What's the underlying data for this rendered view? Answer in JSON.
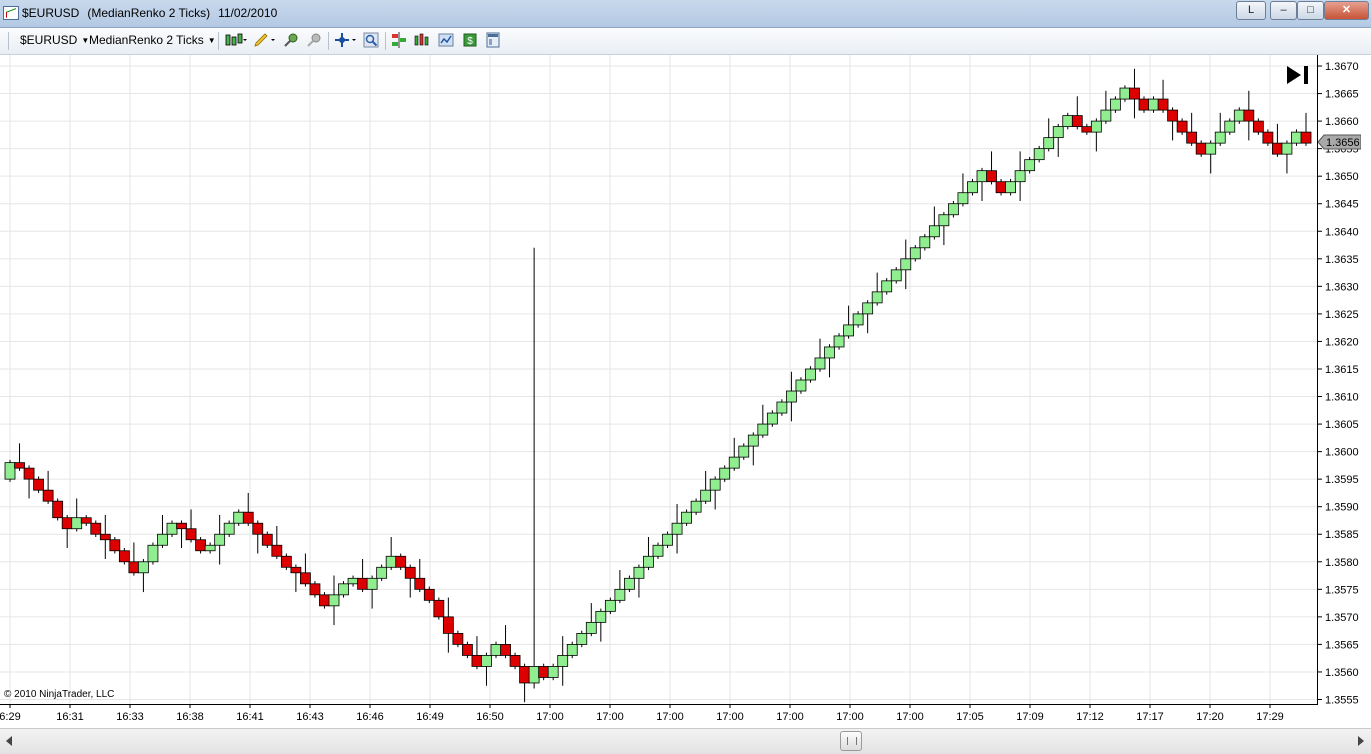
{
  "window": {
    "title_symbol": "$EURUSD",
    "title_type": "(MedianRenko 2 Ticks)",
    "title_date": "11/02/2010",
    "btn_l": "L",
    "btn_min": "–",
    "btn_max": "□",
    "btn_close": "✕"
  },
  "toolbar": {
    "instrument": "$EURUSD",
    "period": "MedianRenko 2 Ticks",
    "icons": [
      "candlestick-style-icon",
      "pencil-draw-icon",
      "zoom-in-icon",
      "zoom-out-icon",
      "crosshair-icon",
      "magnifier-icon",
      "indicators-icon",
      "strategies-icon",
      "chart-properties-icon",
      "data-box-icon",
      "panel-icon"
    ]
  },
  "chart": {
    "copyright": "© 2010 NinjaTrader, LLC",
    "last_price": "1.3656",
    "colors": {
      "up": "#90ee90",
      "down": "#dd0000",
      "outline": "#000000",
      "grid": "#e6e6e6"
    }
  },
  "chart_data": {
    "type": "candlestick",
    "title": "$EURUSD (MedianRenko 2 Ticks)",
    "ylim": [
      1.3554,
      1.3672
    ],
    "y_ticks": [
      "1.3555",
      "1.3560",
      "1.3565",
      "1.3570",
      "1.3575",
      "1.3580",
      "1.3585",
      "1.3590",
      "1.3595",
      "1.3600",
      "1.3605",
      "1.3610",
      "1.3615",
      "1.3620",
      "1.3625",
      "1.3630",
      "1.3635",
      "1.3640",
      "1.3645",
      "1.3650",
      "1.3655",
      "1.3660",
      "1.3665",
      "1.3670"
    ],
    "x_ticks": [
      "6:29",
      "16:31",
      "16:33",
      "16:38",
      "16:41",
      "16:43",
      "16:46",
      "16:49",
      "16:50",
      "17:00",
      "17:00",
      "17:00",
      "17:00",
      "17:00",
      "17:00",
      "17:00",
      "17:05",
      "17:09",
      "17:12",
      "17:17",
      "17:20",
      "17:29"
    ],
    "closes": [
      1.3598,
      1.3597,
      1.3595,
      1.3593,
      1.3591,
      1.3588,
      1.3586,
      1.3588,
      1.3587,
      1.3585,
      1.3584,
      1.3582,
      1.358,
      1.3578,
      1.358,
      1.3583,
      1.3585,
      1.3587,
      1.3586,
      1.3584,
      1.3582,
      1.3583,
      1.3585,
      1.3587,
      1.3589,
      1.3587,
      1.3585,
      1.3583,
      1.3581,
      1.3579,
      1.3578,
      1.3576,
      1.3574,
      1.3572,
      1.3574,
      1.3576,
      1.3577,
      1.3575,
      1.3577,
      1.3579,
      1.3581,
      1.3579,
      1.3577,
      1.3575,
      1.3573,
      1.357,
      1.3567,
      1.3565,
      1.3563,
      1.3561,
      1.3563,
      1.3565,
      1.3563,
      1.3561,
      1.3558,
      1.3561,
      1.3559,
      1.3561,
      1.3563,
      1.3565,
      1.3567,
      1.3569,
      1.3571,
      1.3573,
      1.3575,
      1.3577,
      1.3579,
      1.3581,
      1.3583,
      1.3585,
      1.3587,
      1.3589,
      1.3591,
      1.3593,
      1.3595,
      1.3597,
      1.3599,
      1.3601,
      1.3603,
      1.3605,
      1.3607,
      1.3609,
      1.3611,
      1.3613,
      1.3615,
      1.3617,
      1.3619,
      1.3621,
      1.3623,
      1.3625,
      1.3627,
      1.3629,
      1.3631,
      1.3633,
      1.3635,
      1.3637,
      1.3639,
      1.3641,
      1.3643,
      1.3645,
      1.3647,
      1.3649,
      1.3651,
      1.3649,
      1.3647,
      1.3649,
      1.3651,
      1.3653,
      1.3655,
      1.3657,
      1.3659,
      1.3661,
      1.3659,
      1.3658,
      1.366,
      1.3662,
      1.3664,
      1.3666,
      1.3664,
      1.3662,
      1.3664,
      1.3662,
      1.366,
      1.3658,
      1.3656,
      1.3654,
      1.3656,
      1.3658,
      1.366,
      1.3662,
      1.366,
      1.3658,
      1.3656,
      1.3654,
      1.3656,
      1.3658,
      1.3656
    ],
    "spike_bar_high": 1.3637,
    "spike_bar_low": 1.3558
  }
}
